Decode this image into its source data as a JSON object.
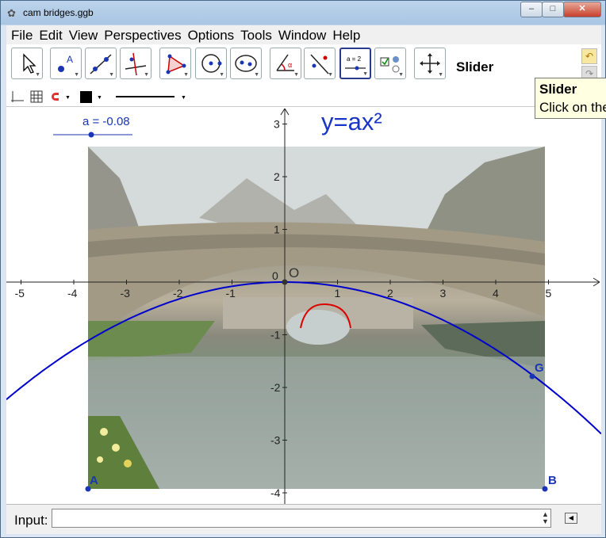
{
  "window": {
    "title": "cam bridges.ggb",
    "controls": {
      "minimize": "–",
      "maximize": "□",
      "close": "✕"
    }
  },
  "menu": [
    "File",
    "Edit",
    "View",
    "Perspectives",
    "Options",
    "Tools",
    "Window",
    "Help"
  ],
  "toolbar": {
    "tools": [
      {
        "name": "move-tool",
        "icon": "arrow-cursor-icon"
      },
      {
        "name": "point-tool",
        "icon": "point-icon",
        "glyph": "A"
      },
      {
        "name": "line-tool",
        "icon": "line-icon"
      },
      {
        "name": "perpendicular-line-tool",
        "icon": "perpendicular-icon"
      },
      {
        "name": "polygon-tool",
        "icon": "polygon-icon"
      },
      {
        "name": "circle-tool",
        "icon": "circle-icon"
      },
      {
        "name": "ellipse-tool",
        "icon": "ellipse-icon"
      },
      {
        "name": "angle-tool",
        "icon": "angle-icon",
        "glyph": "α"
      },
      {
        "name": "reflect-tool",
        "icon": "reflect-icon"
      },
      {
        "name": "slider-tool",
        "icon": "slider-icon",
        "glyph": "a = 2",
        "selected": true
      },
      {
        "name": "checkbox-tool",
        "icon": "checkbox-icon"
      },
      {
        "name": "move-view-tool",
        "icon": "move-view-icon"
      }
    ],
    "selected_tool_name": "Slider",
    "undo_icon": "undo-icon",
    "redo_icon": "redo-icon"
  },
  "tooltip": {
    "title": "Slider",
    "text": "Click on the"
  },
  "graphics": {
    "slider_label": "a = -0.08",
    "formula": "y=ax²",
    "x_ticks": [
      "-5",
      "-4",
      "-3",
      "-2",
      "-1",
      "0",
      "1",
      "2",
      "3",
      "4",
      "5"
    ],
    "y_ticks": [
      "3",
      "2",
      "1",
      "-1",
      "-2",
      "-3",
      "-4"
    ],
    "origin_label": "0",
    "points": {
      "O": "O",
      "G": "G",
      "A": "A",
      "B": "B"
    },
    "curve_color": "#0000cc",
    "arc_color": "#dd0000"
  },
  "input": {
    "label": "Input:",
    "value": ""
  }
}
